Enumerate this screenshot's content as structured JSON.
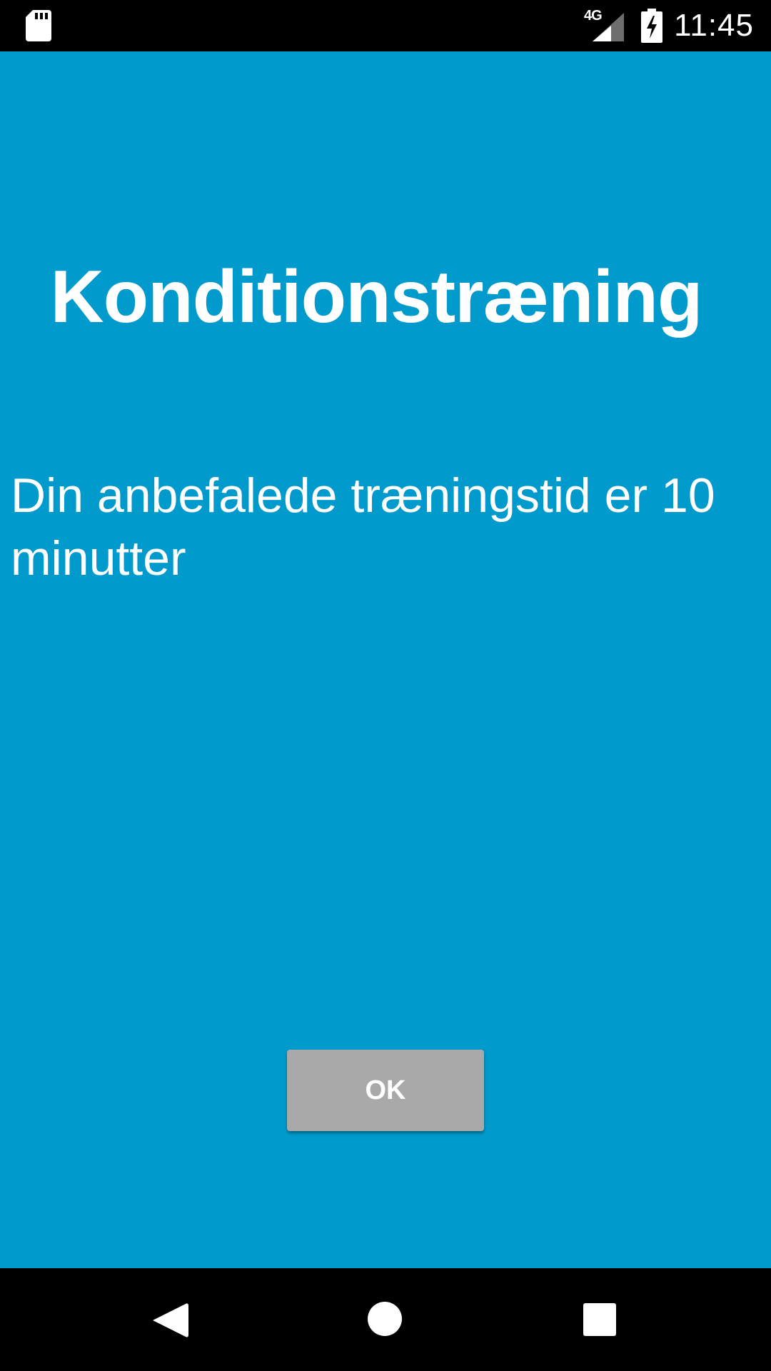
{
  "status_bar": {
    "time": "11:45",
    "network_type": "4G",
    "icons": [
      "sd-card-icon",
      "cellular-signal-icon",
      "battery-charging-icon"
    ]
  },
  "screen": {
    "title": "Konditionstræning",
    "message": "Din anbefalede træningstid er 10 minutter",
    "ok_button_label": "OK",
    "background_color": "#009ACD",
    "button_color": "#A9A9A9"
  },
  "nav_bar": {
    "icons": [
      "back-icon",
      "home-icon",
      "recents-icon"
    ]
  }
}
